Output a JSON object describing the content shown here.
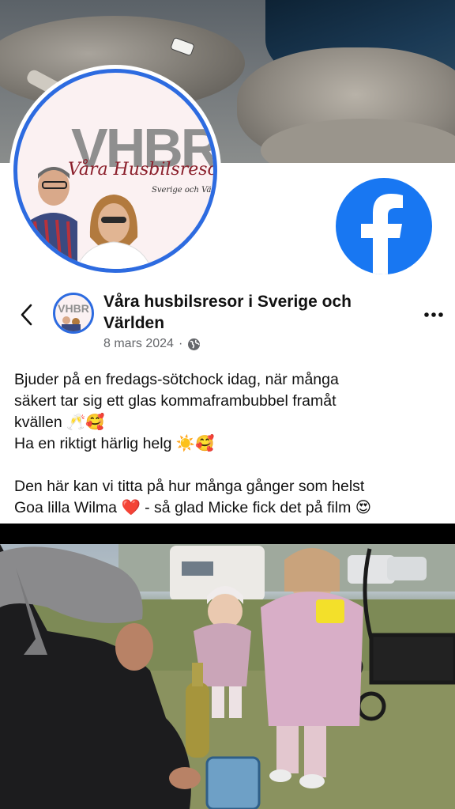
{
  "cover": {
    "description_icon": "cover-photo"
  },
  "profile": {
    "logo_text": "VHBR",
    "logo_script": "Våra Husbilsresor",
    "logo_sub": "Sverige och Världen"
  },
  "header": {
    "page_name": "Våra husbilsresor i Sverige och Världen",
    "date": "8 mars 2024",
    "separator": "·"
  },
  "post": {
    "lines": [
      "Bjuder på en fredags-sötchock idag, när många",
      "säkert tar sig ett glas kommaframbubbel framåt",
      "kvällen 🥂🥰",
      "Ha en riktigt härlig helg ☀️🥰",
      "",
      "Den här kan vi titta på hur många gånger som helst",
      "Goa lilla Wilma ❤️ - så glad Micke fick det på film 😍"
    ]
  },
  "colors": {
    "accent": "#2d6be0",
    "facebook": "#1877f2",
    "meta": "#65676b"
  }
}
